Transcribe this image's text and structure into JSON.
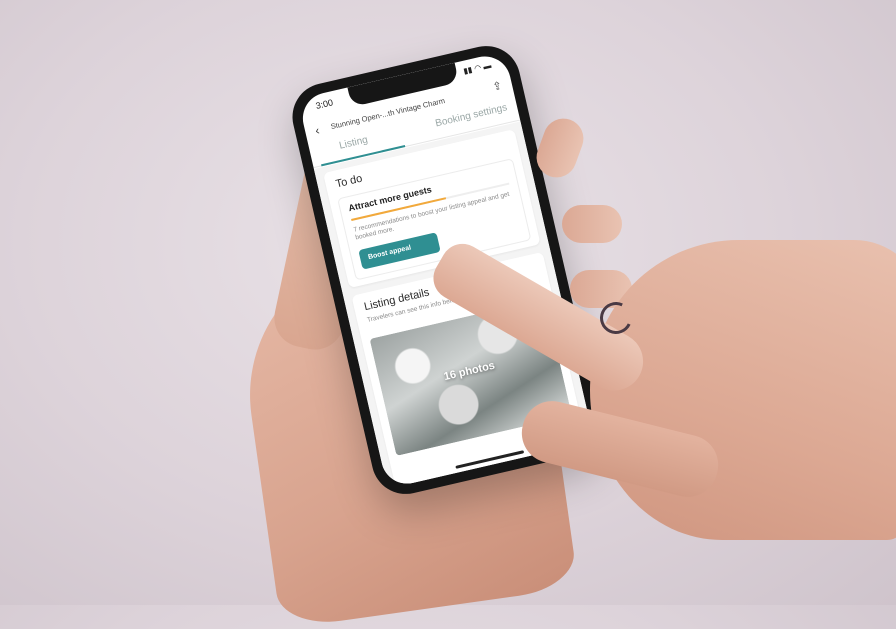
{
  "phone": {
    "status_time": "3:00",
    "status_icons": "▮▮ ◠ ▬",
    "title": "Stunning Open-...th Vintage Charm",
    "back_glyph": "‹",
    "share_glyph": "⇪",
    "tabs": [
      {
        "label": "Listing"
      },
      {
        "label": "Booking settings"
      }
    ],
    "todo": {
      "heading": "To do",
      "card_title": "Attract more guests",
      "recommendation": "7 recommendations to boost your listing appeal and get booked more.",
      "button_label": "Boost appeal",
      "progress": 0.6
    },
    "details": {
      "heading": "Listing details",
      "subtitle": "Travelers can see this info before they book",
      "photo_count": "16 photos"
    }
  },
  "colors": {
    "accent": "#2f8f92",
    "progress": "#f2a93b",
    "background": "#e3dae0"
  }
}
